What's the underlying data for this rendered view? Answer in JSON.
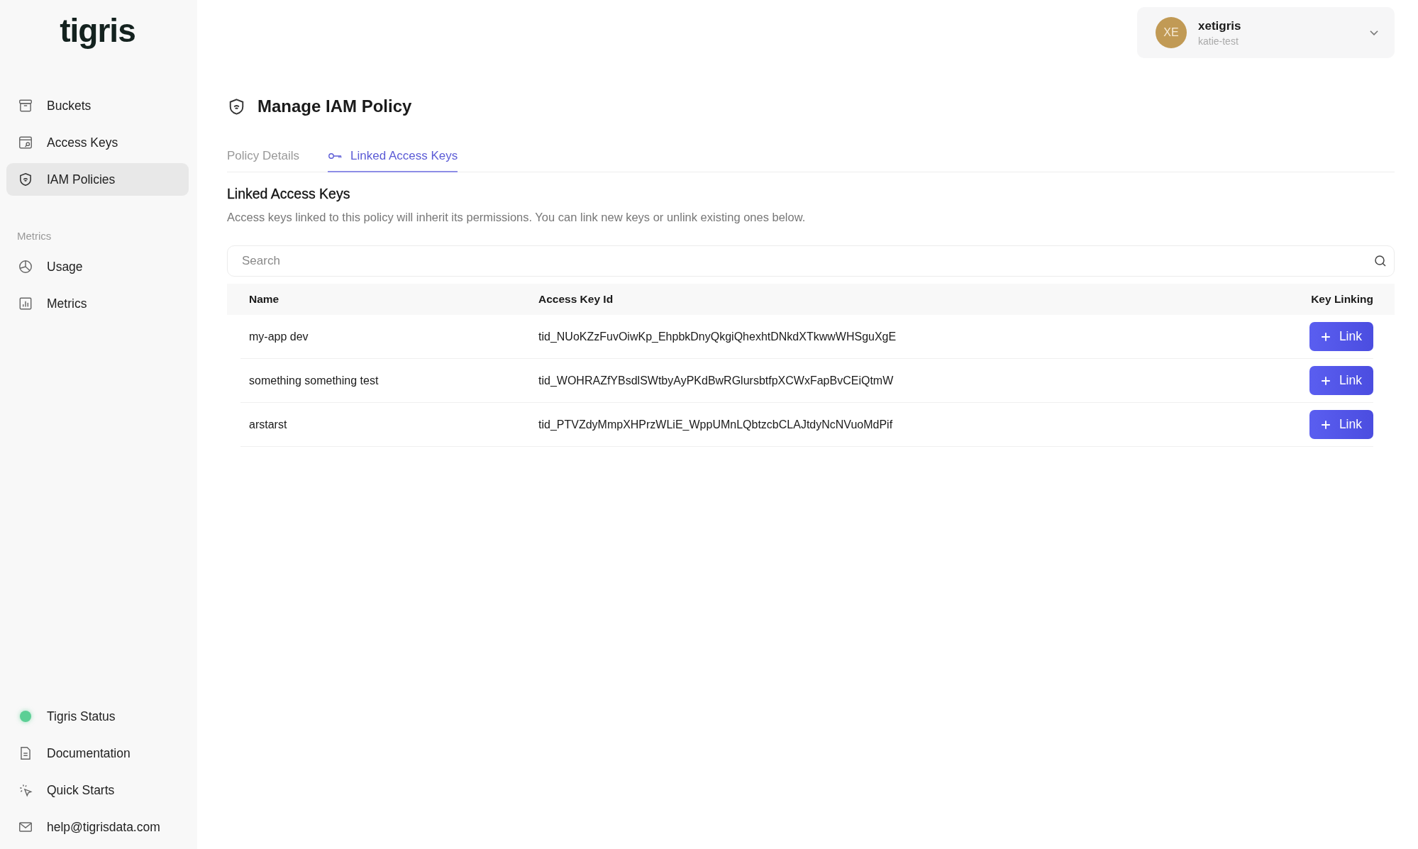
{
  "logo": "tigris",
  "nav": [
    {
      "label": "Buckets",
      "selected": false
    },
    {
      "label": "Access Keys",
      "selected": false
    },
    {
      "label": "IAM Policies",
      "selected": true
    }
  ],
  "metrics_section": {
    "label": "Metrics",
    "items": [
      {
        "label": "Usage",
        "selected": false
      },
      {
        "label": "Metrics",
        "selected": false
      }
    ]
  },
  "footer_items": [
    {
      "kind": "status",
      "label": "Tigris Status",
      "color": "#5ccf95"
    },
    {
      "kind": "link",
      "label": "Documentation"
    },
    {
      "kind": "link",
      "label": "Quick Starts"
    },
    {
      "kind": "link",
      "label": "help@tigrisdata.com"
    }
  ],
  "user": {
    "initials": "XE",
    "name": "xetigris",
    "org": "katie-test"
  },
  "page_title": "Manage IAM Policy",
  "tabs": [
    {
      "label": "Policy Details",
      "selected": false
    },
    {
      "label": "Linked Access Keys",
      "selected": true
    }
  ],
  "section": {
    "title": "Linked Access Keys",
    "description": "Access keys linked to this policy will inherit its permissions. You can link new keys or unlink existing ones below."
  },
  "search": {
    "placeholder": "Search"
  },
  "table": {
    "columns": [
      "Name",
      "Access Key Id",
      "Key Linking"
    ],
    "rows": [
      {
        "name": "my-app dev",
        "key_id": "tid_NUoKZzFuvOiwKp_EhpbkDnyQkgiQhexhtDNkdXTkwwWHSguXgE",
        "action": "Link"
      },
      {
        "name": "something something test",
        "key_id": "tid_WOHRAZfYBsdlSWtbyAyPKdBwRGlursbtfpXCWxFapBvCEiQtmW",
        "action": "Link"
      },
      {
        "name": "arstarst",
        "key_id": "tid_PTVZdyMmpXHPrzWLiE_WppUMnLQbtzcbCLAJtdyNcNVuoMdPif",
        "action": "Link"
      }
    ]
  }
}
